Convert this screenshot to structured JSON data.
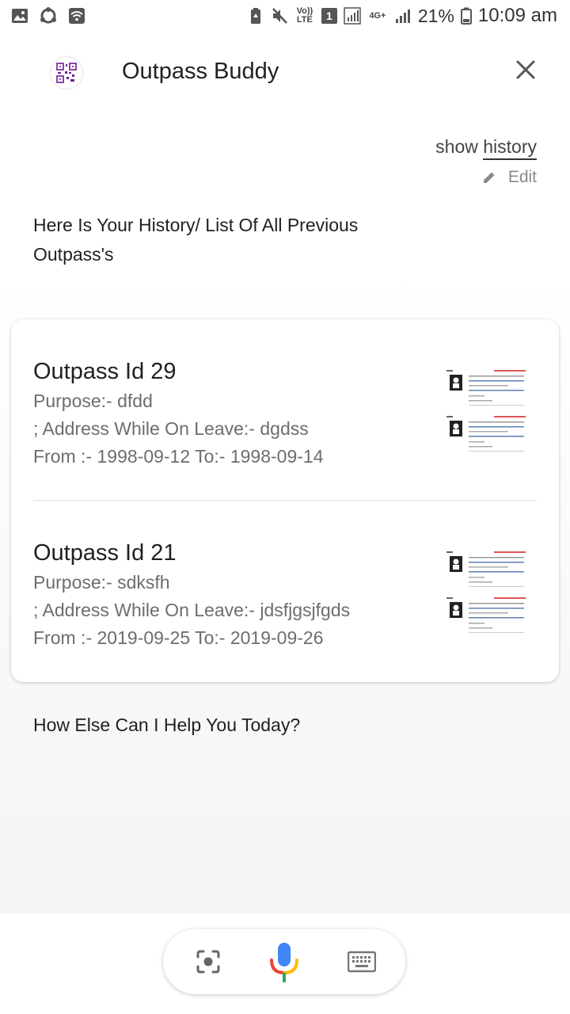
{
  "status_bar": {
    "battery_pct": "21%",
    "time": "10:09 am",
    "volte_label": "Vo)) LTE",
    "sim_label": "1",
    "net_label": "4G+"
  },
  "header": {
    "title": "Outpass Buddy"
  },
  "query": {
    "prefix": "show ",
    "highlight": "history",
    "edit_label": "Edit"
  },
  "response": {
    "text": "Here Is Your History/ List Of All Previous Outpass's"
  },
  "outpasses": [
    {
      "title": "Outpass Id 29",
      "purpose": "Purpose:- dfdd",
      "address": "; Address While On Leave:- dgdss",
      "dates": "From :- 1998-09-12 To:- 1998-09-14"
    },
    {
      "title": "Outpass Id 21",
      "purpose": "Purpose:- sdksfh",
      "address": "; Address While On Leave:- jdsfjgsjfgds",
      "dates": "From :- 2019-09-25 To:- 2019-09-26"
    }
  ],
  "followup": {
    "text": "How Else Can I Help You Today?"
  },
  "colors": {
    "mic_blue": "#4285F4",
    "mic_red": "#EA4335",
    "mic_yellow": "#FBBC05",
    "mic_green": "#34A853"
  }
}
